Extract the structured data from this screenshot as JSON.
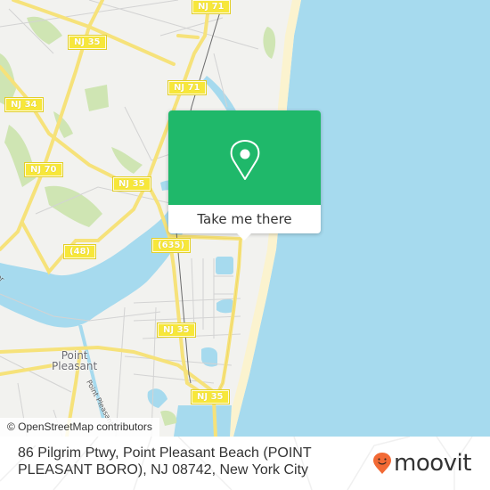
{
  "map": {
    "colors": {
      "land": "#f2f2ef",
      "water": "#a6daee",
      "park": "#cfe5b3",
      "road_major": "#f6e27a",
      "road_minor": "#d3d3d3",
      "beach": "#fbf3cf",
      "rail": "#6b6b6b"
    },
    "route_shields": [
      {
        "label": "NJ 71"
      },
      {
        "label": "NJ 35"
      },
      {
        "label": "NJ 71"
      },
      {
        "label": "NJ 34"
      },
      {
        "label": "NJ 70"
      },
      {
        "label": "NJ 35"
      },
      {
        "label": "(48)"
      },
      {
        "label": "(635)"
      },
      {
        "label": "NJ 35"
      },
      {
        "label": "NJ 35"
      }
    ],
    "place_labels": [
      {
        "line1": "Point",
        "line2": "Pleasant"
      }
    ],
    "street_labels": [
      {
        "label": "Point Pleasant"
      },
      {
        "label": "er"
      }
    ],
    "attribution": "© OpenStreetMap contributors"
  },
  "popup": {
    "icon": "location-pin-icon",
    "color": "#1fb86a",
    "cta_label": "Take me there"
  },
  "footer": {
    "address": "86 Pilgrim Ptwy, Point Pleasant Beach (POINT PLEASANT BORO), NJ 08742, New York City",
    "brand": {
      "name": "moovit",
      "icon": "moovit-smiley-pin-icon",
      "icon_color": "#f26a35"
    }
  }
}
